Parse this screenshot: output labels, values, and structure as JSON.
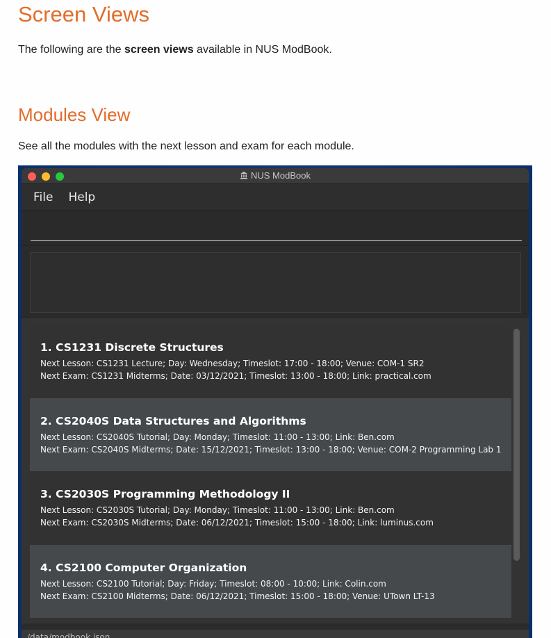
{
  "doc": {
    "heading": "Screen Views",
    "intro_before": "The following are the ",
    "intro_bold": "screen views",
    "intro_after": " available in NUS ModBook.",
    "section_heading": "Modules View",
    "section_desc": "See all the modules with the next lesson and exam for each module."
  },
  "window": {
    "title": "NUS ModBook",
    "menu": [
      "File",
      "Help"
    ],
    "command_value": "",
    "status_path": "/data/modbook.json"
  },
  "modules": [
    {
      "title": "1.  CS1231 Discrete Structures",
      "lesson": "Next Lesson: CS1231 Lecture; Day: Wednesday; Timeslot: 17:00 - 18:00; Venue: COM-1 SR2",
      "exam": "Next Exam: CS1231 Midterms; Date: 03/12/2021; Timeslot: 13:00 - 18:00; Link: practical.com"
    },
    {
      "title": "2.  CS2040S Data Structures and Algorithms",
      "lesson": "Next Lesson: CS2040S Tutorial; Day: Monday; Timeslot: 11:00 - 13:00; Link: Ben.com",
      "exam": "Next Exam: CS2040S Midterms; Date: 15/12/2021; Timeslot: 13:00 - 18:00; Venue: COM-2 Programming Lab 1"
    },
    {
      "title": "3.  CS2030S Programming Methodology II",
      "lesson": "Next Lesson: CS2030S Tutorial; Day: Monday; Timeslot: 11:00 - 13:00; Link: Ben.com",
      "exam": "Next Exam: CS2030S Midterms; Date: 06/12/2021; Timeslot: 15:00 - 18:00; Link: luminus.com"
    },
    {
      "title": "4.  CS2100 Computer Organization",
      "lesson": "Next Lesson: CS2100 Tutorial; Day: Friday; Timeslot: 08:00 - 10:00; Link: Colin.com",
      "exam": "Next Exam: CS2100 Midterms; Date: 06/12/2021; Timeslot: 15:00 - 18:00; Venue: UTown LT-13"
    }
  ],
  "colors": {
    "heading": "#e46c2a",
    "window_bg": "#2b2b2b",
    "card_even": "#45494c"
  },
  "icons": {
    "app": "bank-icon"
  }
}
